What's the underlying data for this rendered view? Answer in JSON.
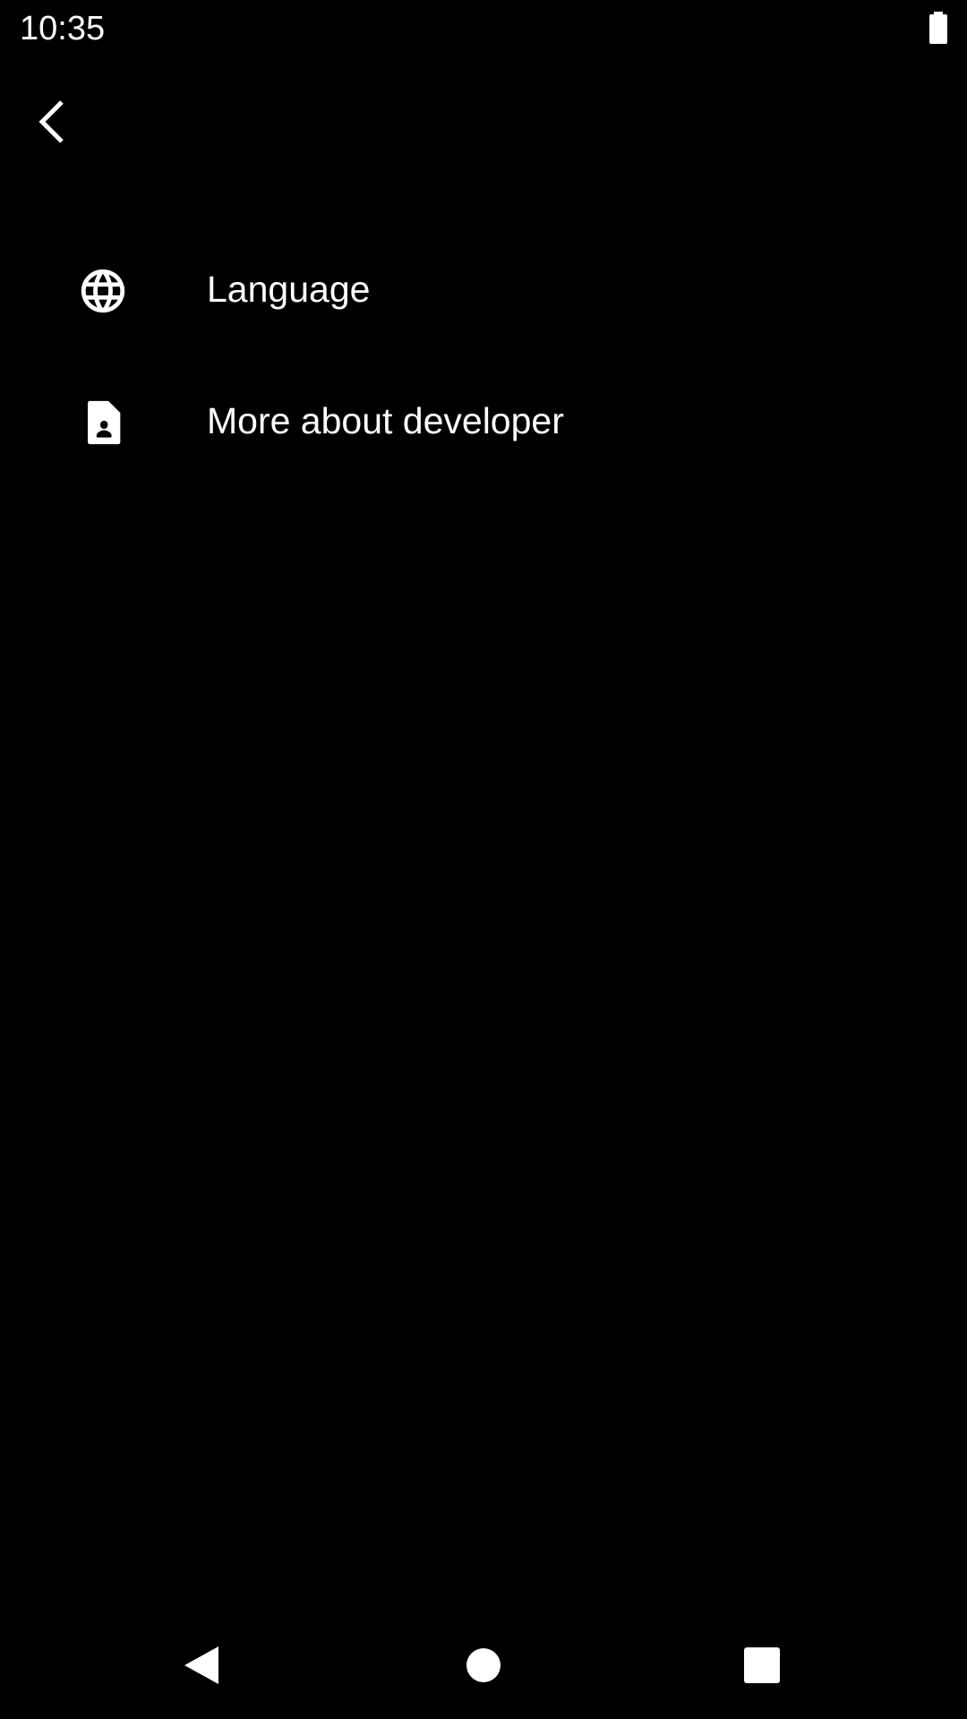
{
  "status_bar": {
    "time": "10:35",
    "battery_icon": "battery-full-icon"
  },
  "toolbar": {
    "back_icon": "chevron-left-icon"
  },
  "menu": {
    "items": [
      {
        "label": "Language",
        "icon": "globe-icon"
      },
      {
        "label": "More about developer",
        "icon": "contact-document-icon"
      }
    ]
  },
  "navigation": {
    "back_icon": "nav-back-triangle-icon",
    "home_icon": "nav-home-circle-icon",
    "recents_icon": "nav-recents-square-icon"
  },
  "colors": {
    "background": "#000000",
    "foreground": "#ffffff"
  }
}
